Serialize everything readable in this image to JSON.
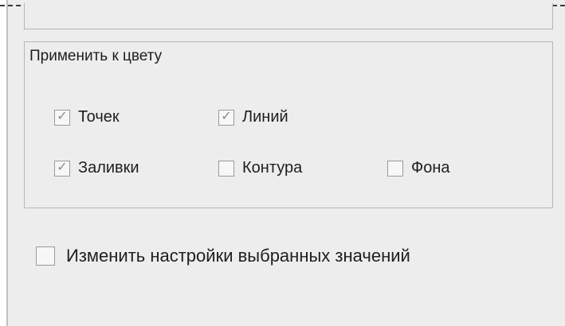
{
  "apply_color": {
    "title": "Применить к цвету",
    "options": [
      {
        "label": "Точек",
        "checked": true
      },
      {
        "label": "Линий",
        "checked": true
      },
      {
        "label": "Заливки",
        "checked": true
      },
      {
        "label": "Контура",
        "checked": false
      },
      {
        "label": "Фона",
        "checked": false
      }
    ]
  },
  "change_selected": {
    "label": "Изменить настройки выбранных значений",
    "checked": false
  },
  "colors": {
    "panel": "#ededed",
    "border": "#b5b5b5",
    "text": "#1e1e1e",
    "check": "#8a8a8a"
  }
}
